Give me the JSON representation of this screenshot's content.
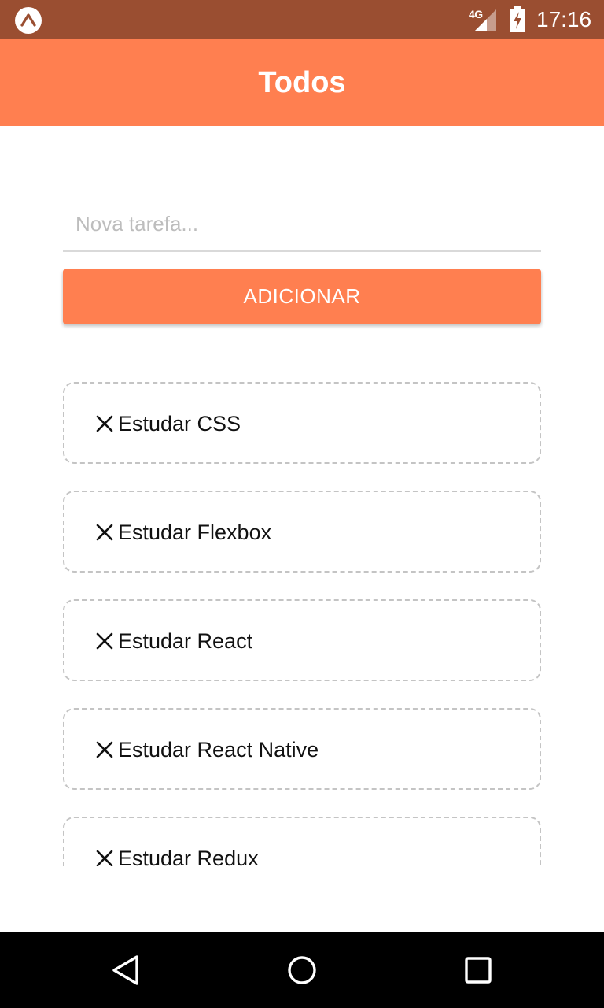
{
  "status_bar": {
    "network": "4G",
    "time": "17:16",
    "icons": [
      "expo-icon",
      "signal-icon",
      "battery-charging-icon"
    ]
  },
  "header": {
    "title": "Todos"
  },
  "form": {
    "input_placeholder": "Nova tarefa...",
    "input_value": "",
    "add_label": "ADICIONAR"
  },
  "tasks": [
    {
      "label": "Estudar CSS",
      "icon": "close-icon"
    },
    {
      "label": "Estudar Flexbox",
      "icon": "close-icon"
    },
    {
      "label": "Estudar React",
      "icon": "close-icon"
    },
    {
      "label": "Estudar React Native",
      "icon": "close-icon"
    },
    {
      "label": "Estudar Redux",
      "icon": "close-icon"
    }
  ],
  "nav_bar": {
    "icons": [
      "back-icon",
      "home-icon",
      "recents-icon"
    ]
  },
  "colors": {
    "status_bar": "#9a4e31",
    "accent": "#ff7f50",
    "text": "#111111",
    "dashed_border": "#c4c4c4",
    "nav_bar": "#000000"
  }
}
